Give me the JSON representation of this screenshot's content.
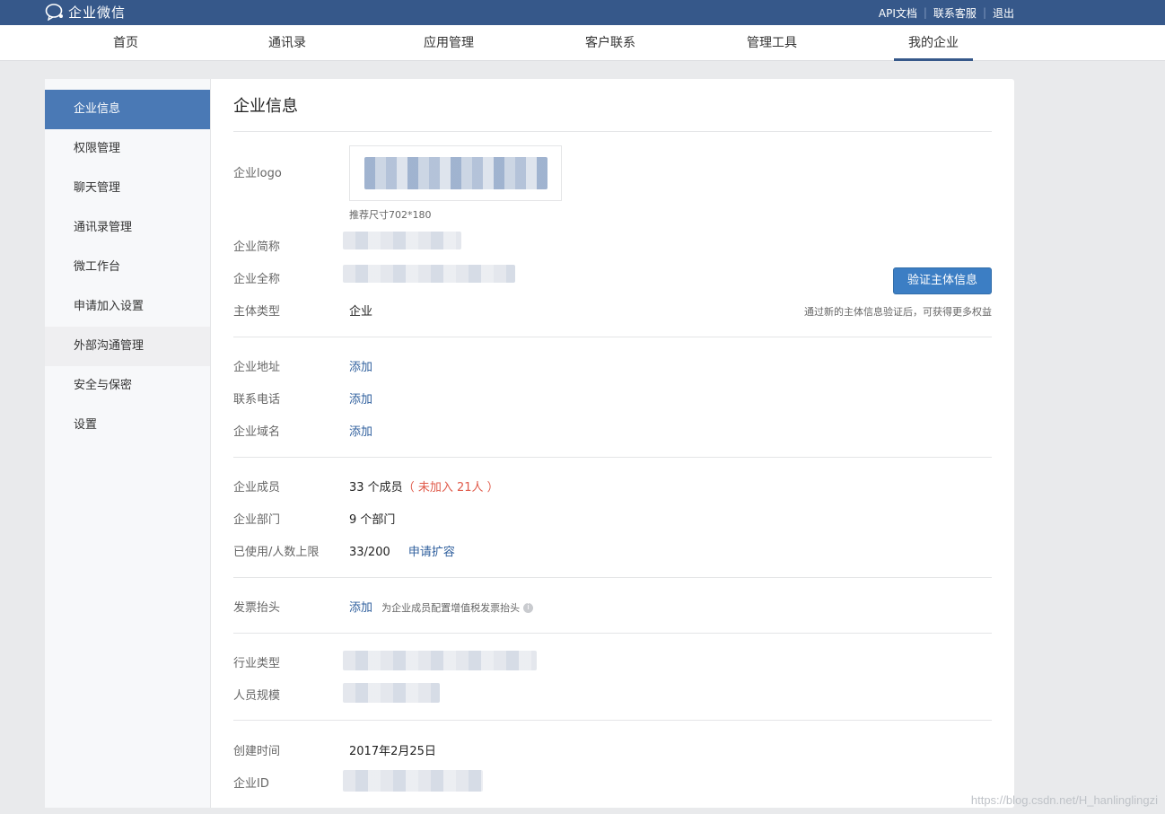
{
  "topbar": {
    "logo_text": "企业微信",
    "links": [
      "API文档",
      "联系客服",
      "退出"
    ]
  },
  "nav": {
    "items": [
      "首页",
      "通讯录",
      "应用管理",
      "客户联系",
      "管理工具",
      "我的企业"
    ],
    "active_index": 5
  },
  "sidebar": {
    "items": [
      "企业信息",
      "权限管理",
      "聊天管理",
      "通讯录管理",
      "微工作台",
      "申请加入设置",
      "外部沟通管理",
      "安全与保密",
      "设置"
    ],
    "active_index": 0
  },
  "main": {
    "title": "企业信息",
    "logo_label": "企业logo",
    "logo_hint": "推荐尺寸702*180",
    "short_name_label": "企业简称",
    "full_name_label": "企业全称",
    "entity_type_label": "主体类型",
    "entity_type_value": "企业",
    "verify_button": "验证主体信息",
    "verify_hint": "通过新的主体信息验证后，可获得更多权益",
    "address_label": "企业地址",
    "address_action": "添加",
    "phone_label": "联系电话",
    "phone_action": "添加",
    "domain_label": "企业域名",
    "domain_action": "添加",
    "members_label": "企业成员",
    "members_value": "33 个成员",
    "members_unjoined": "（ 未加入 21人 ）",
    "departments_label": "企业部门",
    "departments_value": "9 个部门",
    "limit_label": "已使用/人数上限",
    "limit_value": "33/200",
    "limit_action": "申请扩容",
    "invoice_label": "发票抬头",
    "invoice_action": "添加",
    "invoice_hint": "为企业成员配置增值税发票抬头",
    "industry_label": "行业类型",
    "scale_label": "人员规模",
    "created_label": "创建时间",
    "created_value": "2017年2月25日",
    "corp_id_label": "企业ID"
  },
  "watermark": "https://blog.csdn.net/H_hanlinglingzi"
}
